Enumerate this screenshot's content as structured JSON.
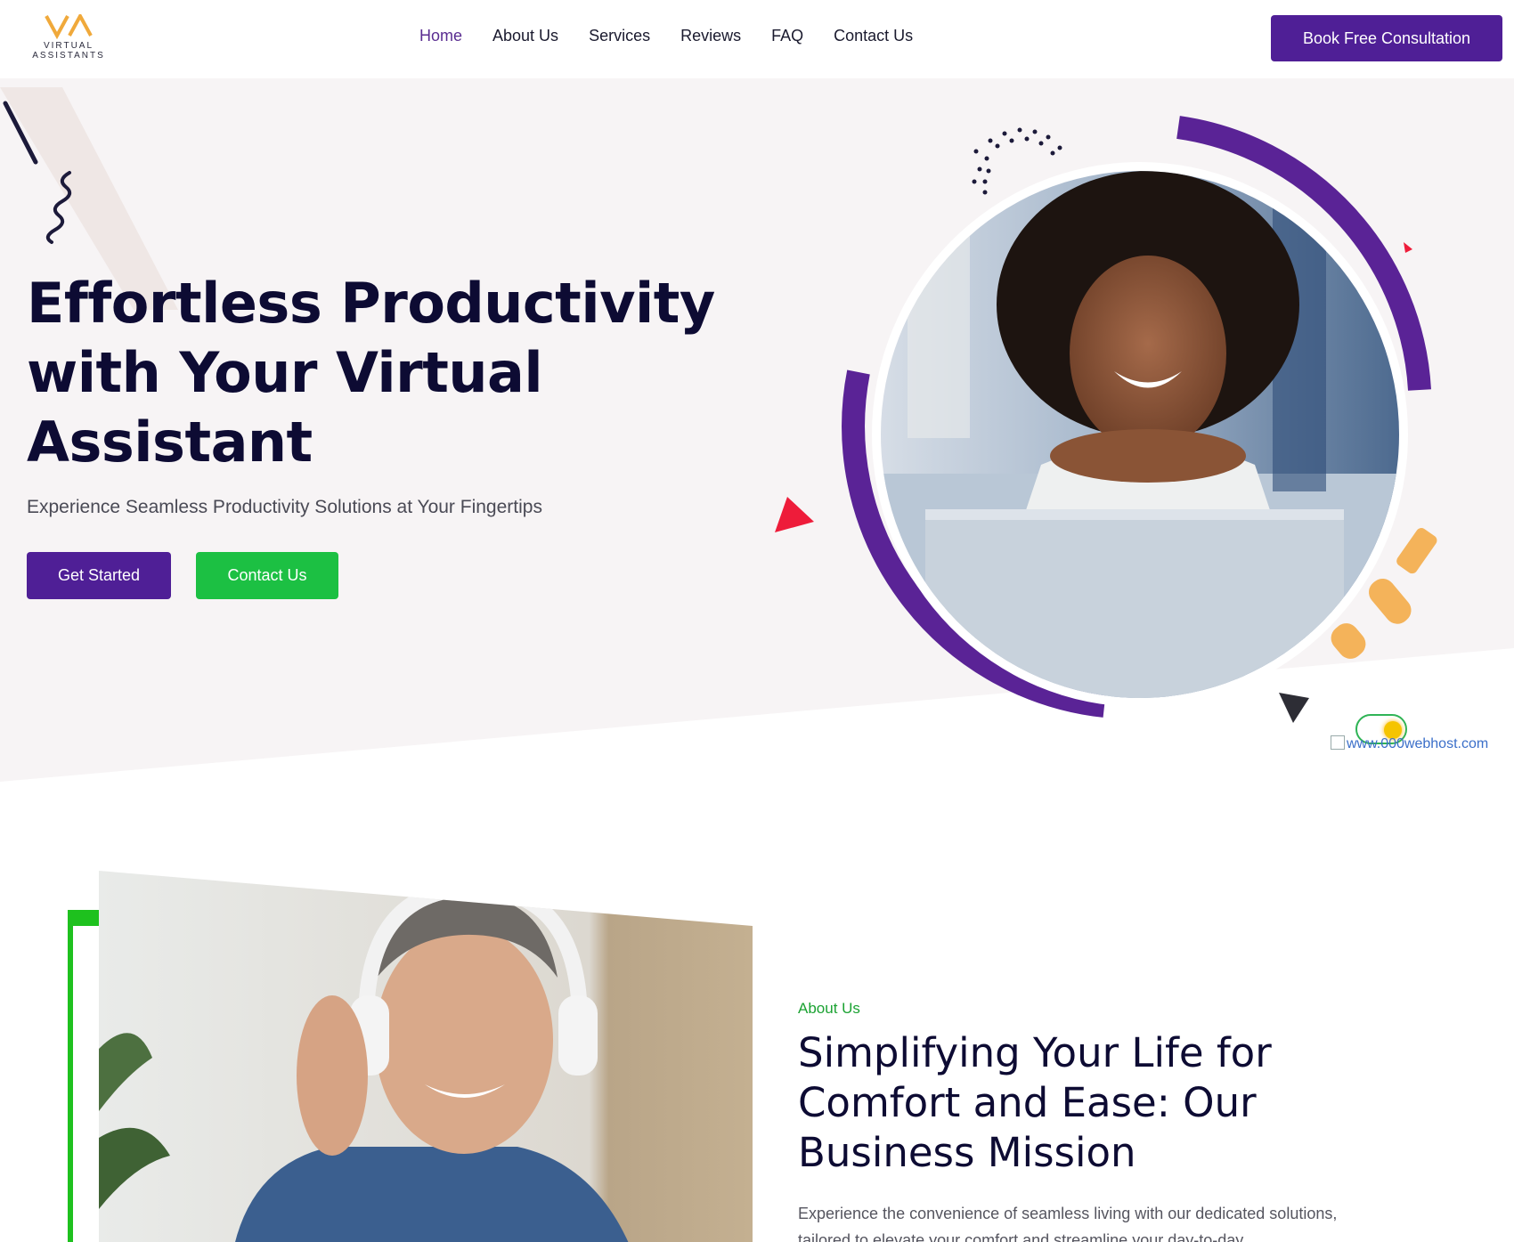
{
  "brand": {
    "logo_line1": "VIRTUAL",
    "logo_line2": "ASSISTANTS",
    "accent_purple": "#4f1f96",
    "accent_green": "#1cc043",
    "accent_orange": "#f4b35a",
    "accent_red": "#ee1c3a"
  },
  "nav": {
    "items": [
      "Home",
      "About Us",
      "Services",
      "Reviews",
      "FAQ",
      "Contact Us"
    ],
    "active": "Home",
    "cta_label": "Book Free Consultation"
  },
  "hero": {
    "title": "Effortless Productivity with Your Virtual Assistant",
    "subtitle": "Experience Seamless Productivity Solutions at Your Fingertips",
    "primary_button": "Get Started",
    "secondary_button": "Contact Us",
    "broken_image_alt": "www.000webhost.com"
  },
  "about": {
    "label": "About Us",
    "title": "Simplifying Your Life for Comfort and Ease: Our Business Mission",
    "body": "Experience the convenience of seamless living with our dedicated solutions, tailored to elevate your comfort and streamline your day-to-day"
  }
}
